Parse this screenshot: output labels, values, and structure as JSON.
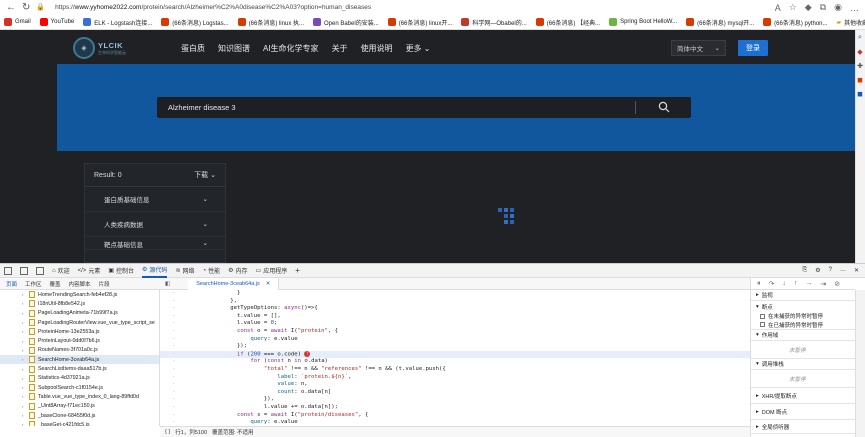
{
  "browser": {
    "url_prefix": "https://",
    "url_host": "www.yyhome2022.com",
    "url_path": "/protein/search/Alzheimer%C2%A0disease%C2%A03?option=human_diseases",
    "bookmarks": [
      {
        "label": "Gmail",
        "color": "#d93025"
      },
      {
        "label": "YouTube",
        "color": "#ff0000"
      },
      {
        "label": "ELK - Logstash连接...",
        "color": "#3b6fd8"
      },
      {
        "label": "(66条消息) Logstas...",
        "color": "#d83b01"
      },
      {
        "label": "(66条消息) linux 执...",
        "color": "#d83b01"
      },
      {
        "label": "Open Babel的安装...",
        "color": "#7a4ab8"
      },
      {
        "label": "(66条消息) linux开...",
        "color": "#d83b01"
      },
      {
        "label": "科学网—Obabel的...",
        "color": "#c0392b"
      },
      {
        "label": "(66条消息) 【经典...",
        "color": "#d83b01"
      },
      {
        "label": "Spring Boot HelloW...",
        "color": "#6db33f"
      },
      {
        "label": "(66条消息) mysql开...",
        "color": "#d83b01"
      },
      {
        "label": "(66条消息) python...",
        "color": "#d83b01"
      }
    ],
    "other_favorites": "其他收藏夹"
  },
  "site": {
    "logo_title": "YLCIK",
    "logo_subtitle": "生命科学智能云",
    "menu": [
      "蛋白质",
      "知识图谱",
      "AI生命化学专家",
      "关于",
      "使用说明",
      "更多"
    ],
    "language": "简体中文",
    "login": "登录",
    "search_value": "Alzheimer disease 3",
    "result_label": "Result: 0",
    "download": "下载",
    "filters": [
      "蛋白质基础信息",
      "人类疾病数据",
      "靶点基础信息"
    ]
  },
  "devtools": {
    "tabs": [
      "欢迎",
      "元素",
      "控制台",
      "源代码",
      "网络",
      "性能",
      "内存",
      "应用程序"
    ],
    "active_tab": "源代码",
    "source_tabs": [
      "页面",
      "工作区",
      "覆盖",
      "内容脚本",
      "片段"
    ],
    "files": [
      "HomeTrendingSearch-feb4ef28.js",
      "I18nUtil-8fb8e542.js",
      "PageLoadingAnimeta-71b99f7a.js",
      "PageLoadingRouterView.vue_vue_type_script_se",
      "ProteinHome-13e2553a.js",
      "ProteinLayout-0dd0f7b6.js",
      "RouteNames-3f701a0c.js",
      "SearchHome-3ceab64a.js",
      "SearchListItems-daaa517b.js",
      "Statistics-4d37921a.js",
      "SubpoolSearch-c1f0154e.js",
      "Table.vue_vue_type_index_0_lang-89ffd0d",
      "_Uint8Array-f71ec150.js",
      "_baseClone-68455f0d.js",
      "_baseGet-c421fdc5.js"
    ],
    "selected_file": "SearchHome-3ceab64a.js",
    "open_file": "SearchHome-3ceab64a.js",
    "code_lines": [
      "        }",
      "      },",
      "      getTypeOptions: async()=>{",
      "        t.value = [],",
      "        l.value = 0;",
      "        const o = await I(\"protein\", {",
      "            query: e.value",
      "        });",
      "        if (200 === o.code)",
      "            for (const n in o.data)",
      "                \"total\" !== n && \"references\" !== n && (t.value.push({",
      "                    label: `protein.${n}`,",
      "                    value: n,",
      "                    count: o.data[n]",
      "                }),",
      "                l.value += o.data[n]);",
      "        const s = await I(\"protein/diseases\", {",
      "            query: e.value",
      "        });",
      "        if (200 === s.code)"
    ],
    "status_position": "行1，列5100",
    "status_coverage": "覆盖范围: 不适用",
    "debugger": {
      "watch": "监视",
      "breakpoints": "断点",
      "pause_uncaught": "在未捕获的异常时暂停",
      "pause_caught": "在已捕获的异常时暂停",
      "scope": "作用域",
      "not_paused": "未暂停",
      "call_stack": "调用堆栈",
      "xhr": "XHR/提取断点",
      "dom": "DOM 断点",
      "global": "全局侦听器"
    }
  }
}
